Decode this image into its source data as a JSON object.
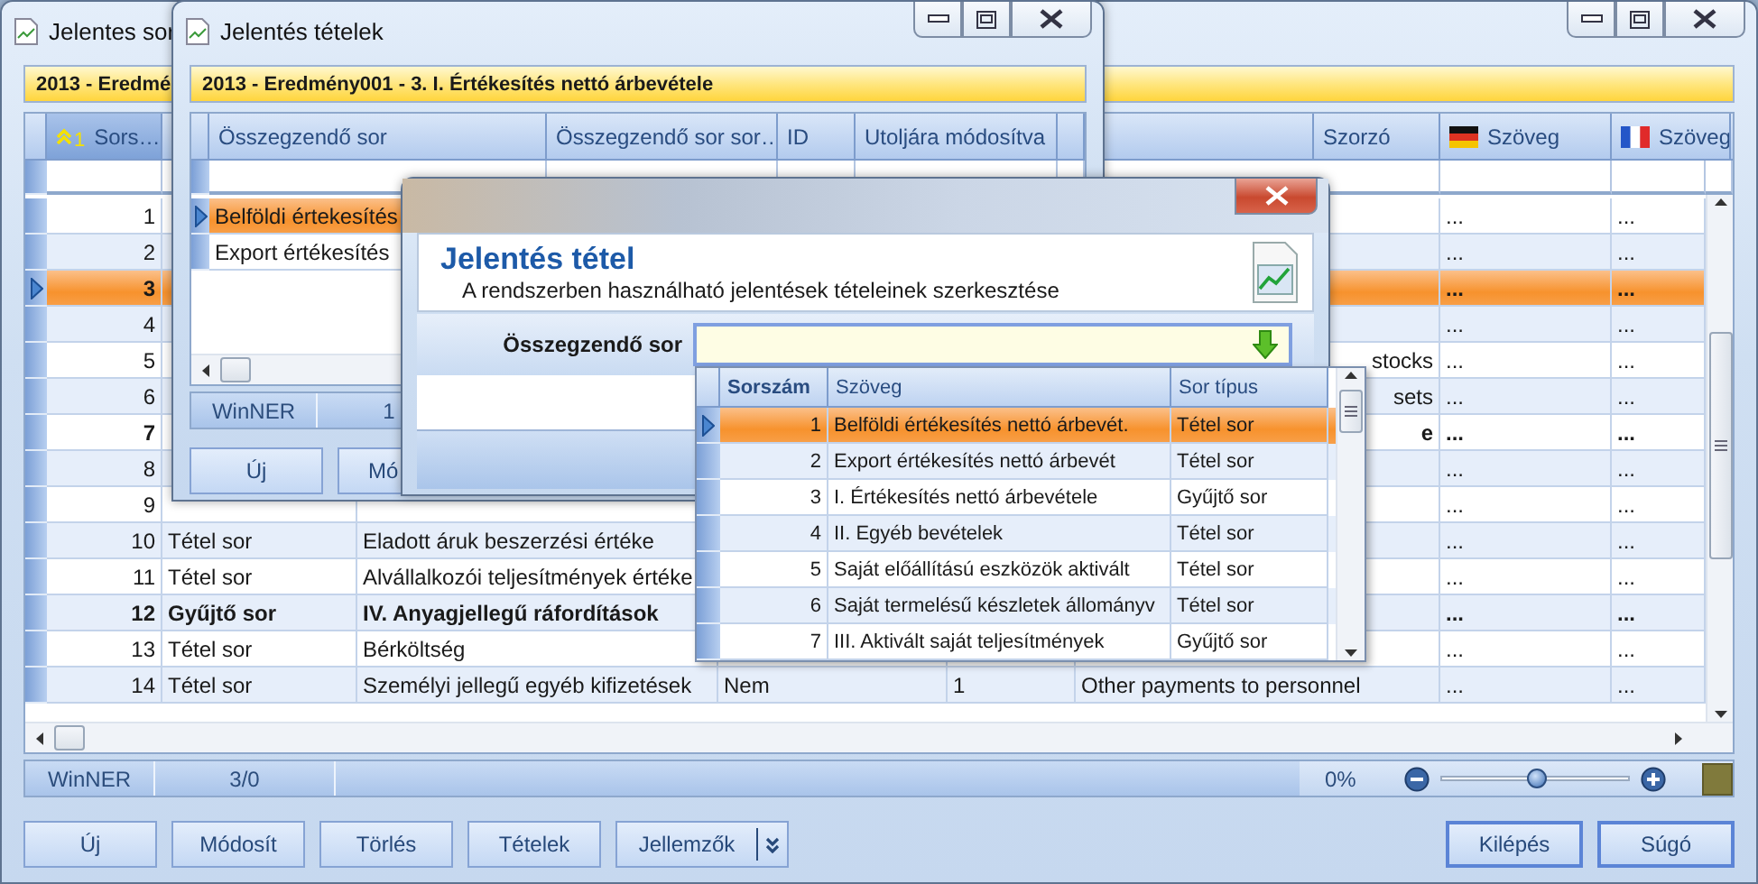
{
  "main_window": {
    "title": "Jelentes sor",
    "header": "2013 - Eredmé",
    "header_cells": [
      {
        "kind": "sort",
        "label": "Sors…",
        "sort_index": "1"
      },
      {
        "kind": "blank"
      },
      {
        "kind": "plain",
        "label": "Szorzó"
      },
      {
        "kind": "germanflag",
        "label": "Szöveg"
      },
      {
        "kind": "frenchflag",
        "label": "Szöveg"
      }
    ],
    "rows": [
      {
        "num": "1",
        "de": "...",
        "fr": "...",
        "bold": false,
        "selected": false
      },
      {
        "num": "2",
        "de": "...",
        "fr": "...",
        "bold": false,
        "selected": false
      },
      {
        "num": "3",
        "de": "...",
        "fr": "...",
        "bold": true,
        "selected": true
      },
      {
        "num": "4",
        "de": "...",
        "fr": "...",
        "bold": false,
        "selected": false
      },
      {
        "num": "5",
        "english_tail": "stocks",
        "de": "...",
        "fr": "...",
        "bold": false,
        "selected": false
      },
      {
        "num": "6",
        "english_tail": "sets",
        "de": "...",
        "fr": "...",
        "bold": false,
        "selected": false
      },
      {
        "num": "7",
        "english_tail": "e",
        "de": "...",
        "fr": "...",
        "bold": true,
        "selected": false
      },
      {
        "num": "8",
        "de": "...",
        "fr": "...",
        "bold": false,
        "selected": false
      },
      {
        "num": "9",
        "de": "...",
        "fr": "...",
        "bold": false,
        "selected": false
      },
      {
        "num": "10",
        "type": "Tétel sor",
        "text": "Eladott áruk beszerzési értéke",
        "de": "...",
        "fr": "...",
        "bold": false,
        "selected": false
      },
      {
        "num": "11",
        "type": "Tétel sor",
        "text": "Alvállalkozói teljesítmények értéke",
        "de": "...",
        "fr": "...",
        "bold": false,
        "selected": false
      },
      {
        "num": "12",
        "type": "Gyűjtő sor",
        "text": "IV. Anyagjellegű ráfordítások",
        "de": "...",
        "fr": "...",
        "bold": true,
        "selected": false
      },
      {
        "num": "13",
        "type": "Tétel sor",
        "text": "Bérköltség",
        "de": "...",
        "fr": "...",
        "bold": false,
        "selected": false
      },
      {
        "num": "14",
        "type": "Tétel sor",
        "text": "Személyi jellegű egyéb kifizetések",
        "col4": "Nem",
        "col5": "1",
        "english": "Other payments to personnel",
        "de": "...",
        "fr": "...",
        "bold": false,
        "selected": false
      }
    ],
    "status": {
      "app": "WinNER",
      "count": "3/0",
      "zoom": "0%",
      "zoom_level": {
        "level": 0.5
      }
    },
    "buttons": [
      {
        "label": "Új",
        "kind": "plain"
      },
      {
        "label": "Módosít",
        "kind": "plain"
      },
      {
        "label": "Törlés",
        "kind": "plain"
      },
      {
        "label": "Tételek",
        "kind": "plain"
      },
      {
        "label": "Jellemzők",
        "kind": "split"
      }
    ],
    "right_buttons": [
      {
        "label": "Kilépés"
      },
      {
        "label": "Súgó"
      }
    ]
  },
  "items_window": {
    "title": "Jelentés tételek",
    "header": "2013 - Eredmény001 - 3. I.  Értékesítés nettó árbevétele",
    "columns": [
      "Összegzendő sor",
      "Összegzendő sor sor…",
      "ID",
      "Utoljára módosítva"
    ],
    "rows": [
      {
        "text": "Belföldi értekesítés",
        "selected": true
      },
      {
        "text": "Export értékesítés",
        "selected": false
      }
    ],
    "status": [
      "WinNER",
      "1"
    ],
    "buttons": [
      {
        "label": "Új",
        "kind": "plain"
      },
      {
        "label": "Mó",
        "kind": "cut"
      }
    ]
  },
  "dialog": {
    "title": "Jelentés tétel",
    "subtitle": "A rendszerben használható jelentések tételeinek szerkesztése",
    "field_label": "Összegzendő sor",
    "dropdown": {
      "columns": [
        "Sorszám",
        "Szöveg",
        "Sor típus"
      ],
      "rows": [
        {
          "num": "1",
          "text": "Belföldi értékesítés nettó árbevét.",
          "type": "Tétel sor",
          "selected": true
        },
        {
          "num": "2",
          "text": "Export értékesítés nettó árbevét",
          "type": "Tétel sor",
          "selected": false
        },
        {
          "num": "3",
          "text": "I.  Értékesítés nettó árbevétele",
          "type": "Gyűjtő sor",
          "selected": false
        },
        {
          "num": "4",
          "text": "II. Egyéb bevételek",
          "type": "Tétel sor",
          "selected": false
        },
        {
          "num": "5",
          "text": "Saját előállítású eszközök aktivált",
          "type": "Tétel sor",
          "selected": false
        },
        {
          "num": "6",
          "text": "Saját termelésű készletek állományv",
          "type": "Tétel sor",
          "selected": false
        },
        {
          "num": "7",
          "text": "III. Aktivált saját teljesítmények",
          "type": "Gyűjtő sor",
          "selected": false
        }
      ]
    }
  }
}
